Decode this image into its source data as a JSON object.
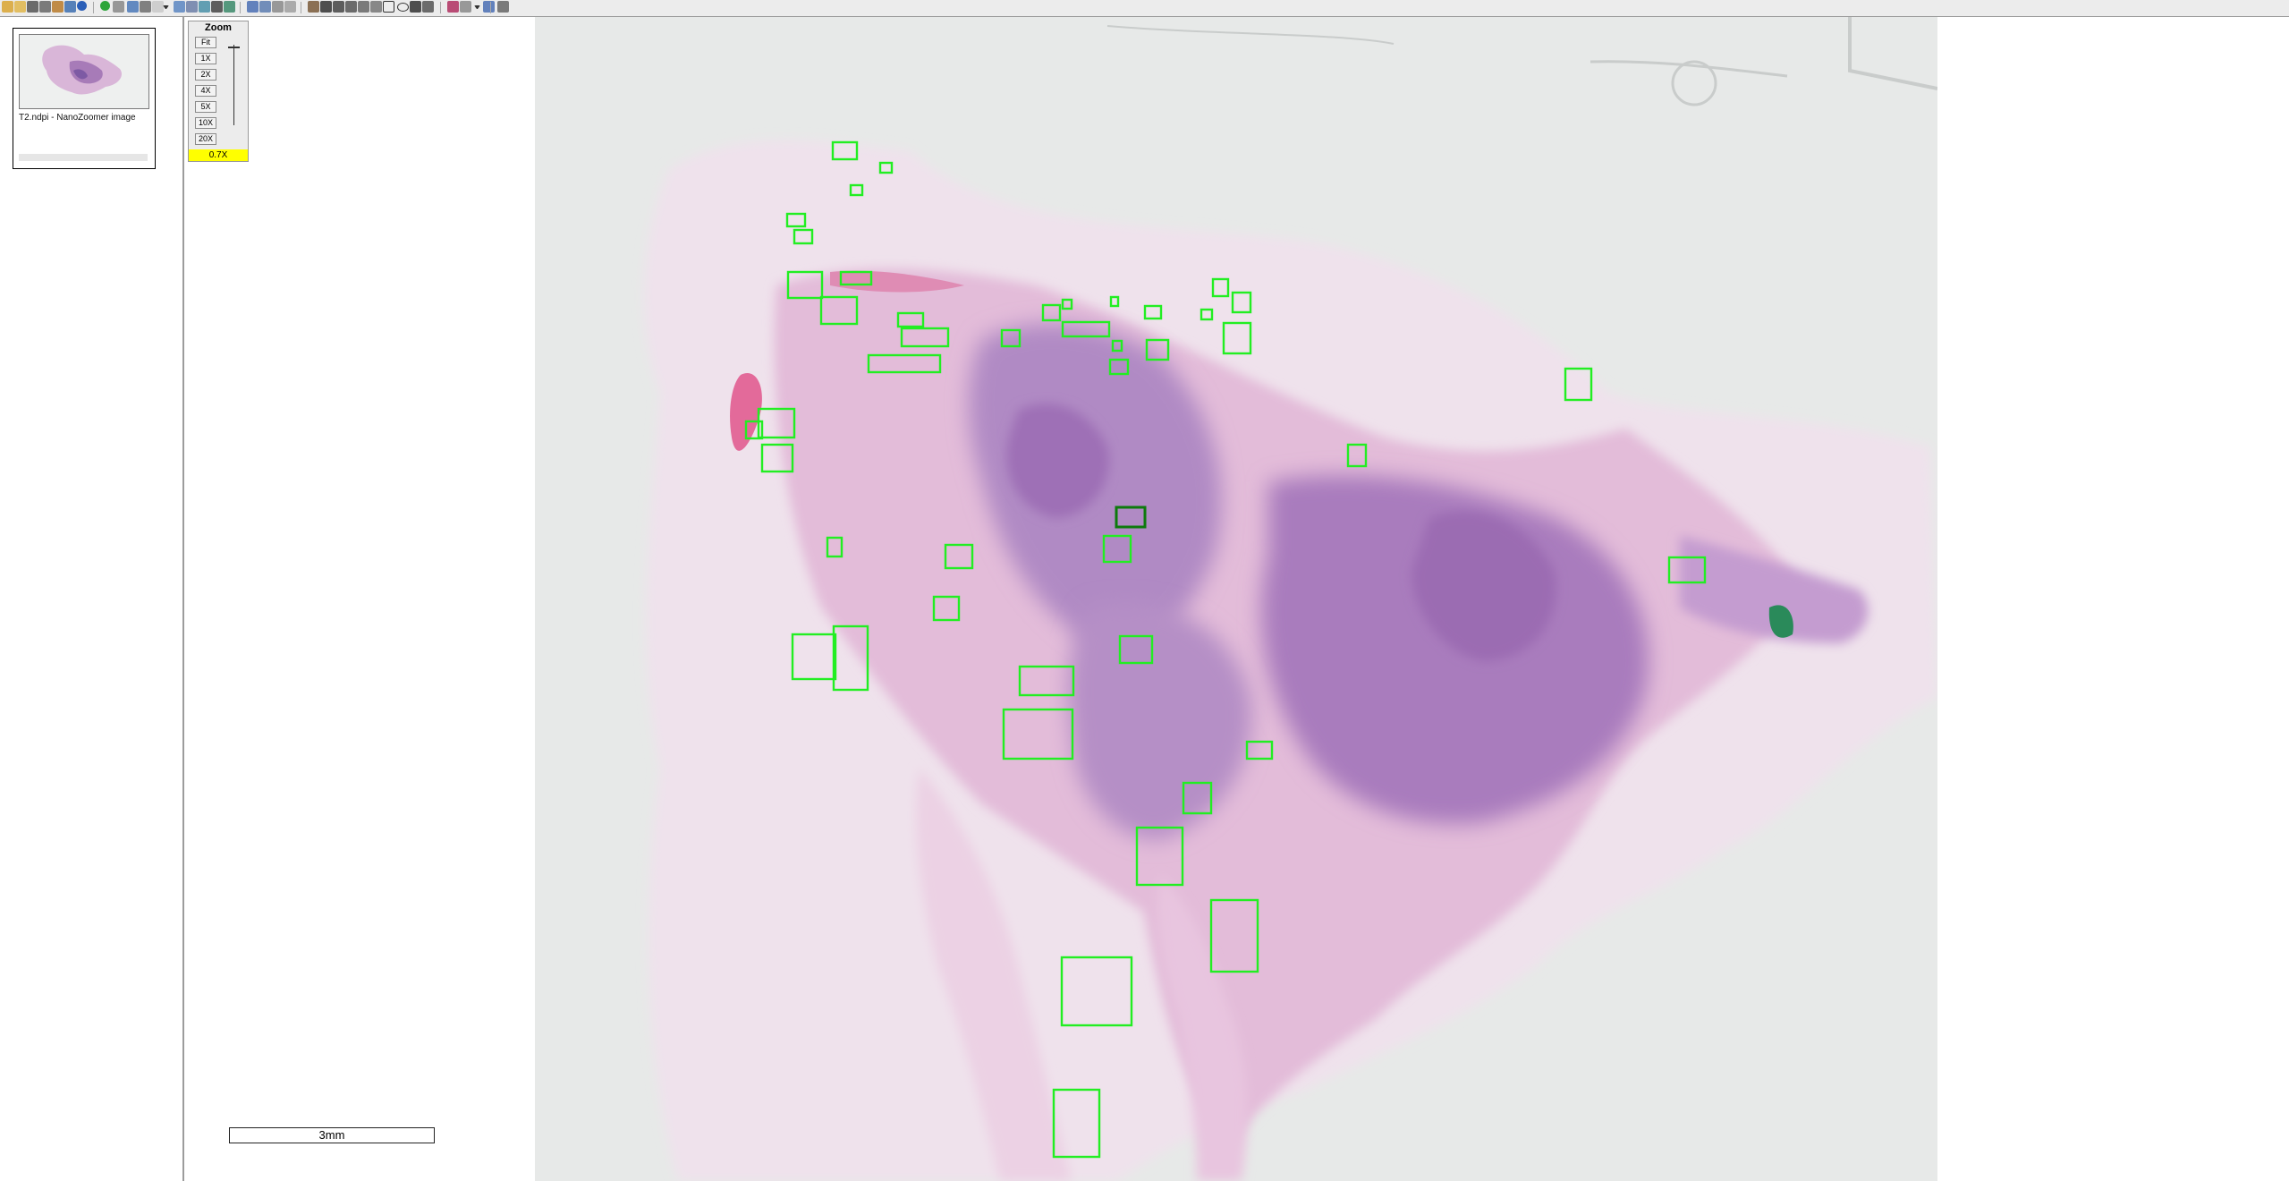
{
  "thumbnail": {
    "caption": "T2.ndpi - NanoZoomer image"
  },
  "zoom": {
    "title": "Zoom",
    "buttons": [
      "Fit",
      "1X",
      "2X",
      "4X",
      "5X",
      "10X",
      "20X"
    ],
    "current": "0.7X"
  },
  "scale_bar": {
    "label": "3mm"
  },
  "colors": {
    "annotation": "#22ee22",
    "selected_annotation": "#0d7a0d",
    "zoom_indicator": "#ffff00",
    "background": "#e7e9e8"
  },
  "toolbar_icons": [
    "open-folder-icon",
    "folder-icon",
    "camera-icon",
    "print-icon",
    "tools-icon",
    "tree-icon",
    "info-icon",
    "go-icon",
    "settings-icon",
    "layout-icon",
    "share-icon",
    "page-icon",
    "dropdown-icon",
    "frame-icon",
    "copy-icon",
    "export-icon",
    "magnifier-icon",
    "overview-icon",
    "annotate-icon",
    "annotate-list-icon",
    "annotate-edit-icon",
    "annotate-delete-icon",
    "hand-pan-icon",
    "pointer-icon",
    "snapshot-icon",
    "pin-icon",
    "measure-icon",
    "ruler-icon",
    "rectangle-tool-icon",
    "ellipse-tool-icon",
    "arrow-tool-icon",
    "annotation-table-icon",
    "color-icon",
    "brightness-icon",
    "dropdown-icon",
    "help-icon",
    "pen-icon"
  ]
}
